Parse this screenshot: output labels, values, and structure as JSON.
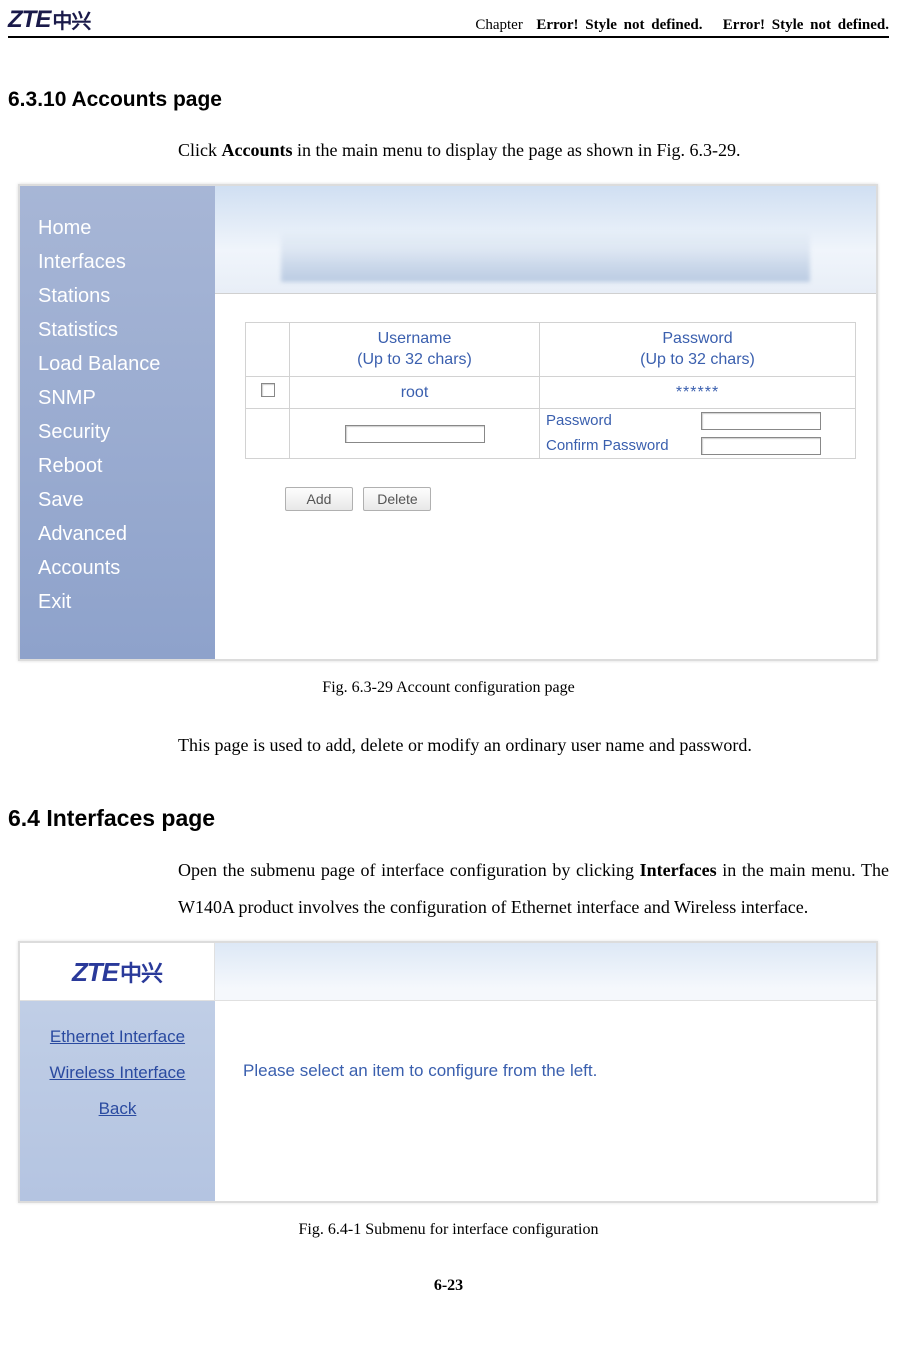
{
  "header": {
    "logo_main": "ZTE",
    "logo_cn": "中兴",
    "chapter_prefix": "Chapter",
    "err1": "Error! Style not defined.",
    "err2": "Error! Style not defined."
  },
  "sec1": {
    "heading": "6.3.10 Accounts page",
    "para1_pre": "Click ",
    "para1_bold": "Accounts",
    "para1_post": " in the main menu to display the page as shown in Fig. 6.3-29.",
    "caption": "Fig. 6.3-29    Account configuration page",
    "para2": "This page is used to add, delete or modify an ordinary user name and password."
  },
  "shot1": {
    "menu": [
      "Home",
      "Interfaces",
      "Stations",
      "Statistics",
      "Load Balance",
      "SNMP",
      "Security",
      "Reboot",
      "Save",
      "Advanced",
      "Accounts",
      "Exit"
    ],
    "th_user_l1": "Username",
    "th_user_l2": "(Up to 32 chars)",
    "th_pass_l1": "Password",
    "th_pass_l2": "(Up to 32 chars)",
    "row1_user": "root",
    "row1_pass": "******",
    "lbl_password": "Password",
    "lbl_confirm": "Confirm Password",
    "btn_add": "Add",
    "btn_delete": "Delete"
  },
  "sec2": {
    "heading": "6.4 Interfaces page",
    "para_pre": "Open the submenu page of interface configuration by clicking ",
    "para_bold": "Interfaces",
    "para_post": " in the main menu. The W140A product involves the configuration of Ethernet interface and Wireless interface.",
    "caption": "Fig. 6.4-1    Submenu for interface configuration"
  },
  "shot2": {
    "logo_main": "ZTE",
    "logo_cn": "中兴",
    "menu": [
      "Ethernet Interface",
      "Wireless Interface",
      "Back"
    ],
    "prompt": "Please select an item to configure from the left."
  },
  "footer": {
    "page_num": "6-23"
  }
}
